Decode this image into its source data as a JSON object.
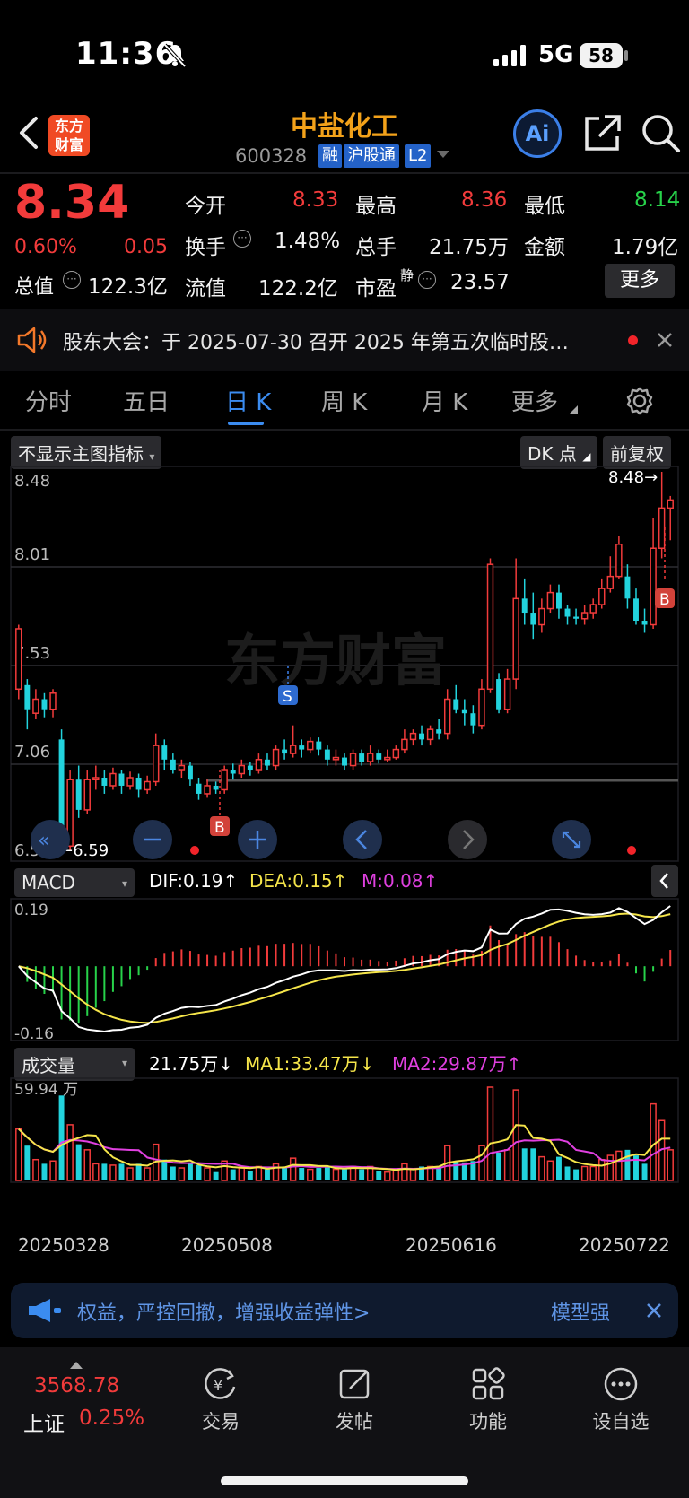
{
  "status": {
    "time": "11:36",
    "network": "5G",
    "battery": "58"
  },
  "nav": {
    "title": "中盐化工",
    "logo_line1": "东方",
    "logo_line2": "财富",
    "code": "600328",
    "badges": [
      "融",
      "沪股通",
      "L2"
    ],
    "ai_label": "Ai"
  },
  "quote": {
    "price": "8.34",
    "change_pct": "0.60%",
    "change": "0.05",
    "open_label": "今开",
    "open": "8.33",
    "high_label": "最高",
    "high": "8.36",
    "low_label": "最低",
    "low": "8.14",
    "turnover_label": "换手",
    "turnover": "1.48%",
    "volume_label": "总手",
    "volume": "21.75万",
    "amount_label": "金额",
    "amount": "1.79亿",
    "mktcap_label": "总值",
    "mktcap": "122.3亿",
    "float_label": "流值",
    "float_cap": "122.2亿",
    "pe_label": "市盈",
    "pe_sup": "静",
    "pe": "23.57",
    "more_label": "更多"
  },
  "notice": {
    "text": "股东大会：于 2025-07-30 召开 2025 年第五次临时股…"
  },
  "tabs": [
    "分时",
    "五日",
    "日 K",
    "周 K",
    "月 K",
    "更多"
  ],
  "kline": {
    "indicator_select": "不显示主图指标",
    "dk_label": "DK 点",
    "adjust_label": "前复权",
    "y_labels": [
      "8.48",
      "8.01",
      "7.53",
      "7.06",
      "6.59"
    ],
    "max_marker": "8.48→",
    "min_marker": "←6.59",
    "watermark": "东方财富",
    "markers": {
      "sell": "S",
      "buy": "B"
    }
  },
  "macd": {
    "select": "MACD",
    "dif": "DIF:0.19↑",
    "dea": "DEA:0.15↑",
    "m": "M:0.08↑",
    "y_top": "0.19",
    "y_bottom": "-0.16"
  },
  "vol": {
    "select": "成交量",
    "value": "21.75万↓",
    "ma1": "MA1:33.47万↓",
    "ma2": "MA2:29.87万↑",
    "y_top": "59.94 万",
    "dates": [
      "20250328",
      "20250508",
      "20250616",
      "20250722"
    ]
  },
  "banner": {
    "text": "权益，严控回撤，增强收益弹性>",
    "right": "模型强"
  },
  "bottom_nav": {
    "index_value": "3568.78",
    "index_name": "上证",
    "index_pct": "0.25%",
    "items": [
      "交易",
      "发帖",
      "功能",
      "设自选"
    ]
  },
  "colors": {
    "up": "#f23b3b",
    "down": "#22d3dd",
    "accent": "#3b8cf0",
    "ma1": "#f5e54a",
    "ma2": "#e040e0"
  },
  "chart_data": {
    "type": "candlestick",
    "ylim": [
      6.59,
      8.48
    ],
    "candles": [
      [
        7.4,
        7.7,
        7.72,
        7.35
      ],
      [
        7.42,
        7.3,
        7.45,
        7.2
      ],
      [
        7.28,
        7.35,
        7.4,
        7.25
      ],
      [
        7.35,
        7.3,
        7.38,
        7.26
      ],
      [
        7.3,
        7.38,
        7.4,
        7.26
      ],
      [
        7.15,
        6.62,
        7.2,
        6.59
      ],
      [
        6.62,
        6.95,
        7.0,
        6.6
      ],
      [
        6.95,
        6.8,
        7.02,
        6.76
      ],
      [
        6.8,
        6.95,
        7.0,
        6.78
      ],
      [
        6.95,
        6.96,
        7.02,
        6.9
      ],
      [
        6.96,
        6.92,
        7.0,
        6.88
      ],
      [
        6.92,
        6.98,
        7.01,
        6.9
      ],
      [
        6.98,
        6.92,
        7.0,
        6.88
      ],
      [
        6.92,
        6.96,
        6.99,
        6.9
      ],
      [
        6.96,
        6.9,
        6.98,
        6.86
      ],
      [
        6.9,
        6.94,
        6.97,
        6.88
      ],
      [
        6.94,
        7.12,
        7.18,
        6.92
      ],
      [
        7.12,
        7.05,
        7.15,
        7.0
      ],
      [
        7.05,
        7.0,
        7.08,
        6.98
      ],
      [
        7.0,
        7.02,
        7.05,
        6.96
      ],
      [
        7.02,
        6.95,
        7.04,
        6.92
      ],
      [
        6.93,
        6.88,
        6.96,
        6.85
      ],
      [
        6.88,
        6.92,
        6.95,
        6.86
      ],
      [
        6.92,
        6.9,
        6.94,
        6.88
      ],
      [
        6.9,
        7.0,
        7.02,
        6.88
      ],
      [
        7.0,
        6.98,
        7.03,
        6.95
      ],
      [
        6.98,
        7.02,
        7.05,
        6.96
      ],
      [
        7.02,
        7.0,
        7.04,
        6.97
      ],
      [
        7.0,
        7.05,
        7.08,
        6.98
      ],
      [
        7.05,
        7.02,
        7.08,
        7.0
      ],
      [
        7.02,
        7.1,
        7.12,
        7.0
      ],
      [
        7.1,
        7.08,
        7.15,
        7.05
      ],
      [
        7.08,
        7.12,
        7.22,
        7.06
      ],
      [
        7.12,
        7.1,
        7.15,
        7.06
      ],
      [
        7.1,
        7.14,
        7.16,
        7.08
      ],
      [
        7.14,
        7.1,
        7.16,
        7.07
      ],
      [
        7.1,
        7.05,
        7.12,
        7.02
      ],
      [
        7.05,
        7.06,
        7.1,
        7.02
      ],
      [
        7.06,
        7.02,
        7.08,
        7.0
      ],
      [
        7.02,
        7.08,
        7.1,
        7.0
      ],
      [
        7.08,
        7.04,
        7.1,
        7.02
      ],
      [
        7.04,
        7.08,
        7.12,
        7.02
      ],
      [
        7.08,
        7.05,
        7.1,
        7.03
      ],
      [
        7.05,
        7.06,
        7.1,
        7.04
      ],
      [
        7.06,
        7.1,
        7.12,
        7.05
      ],
      [
        7.1,
        7.15,
        7.2,
        7.08
      ],
      [
        7.15,
        7.18,
        7.2,
        7.12
      ],
      [
        7.18,
        7.15,
        7.22,
        7.12
      ],
      [
        7.15,
        7.2,
        7.22,
        7.12
      ],
      [
        7.2,
        7.18,
        7.25,
        7.15
      ],
      [
        7.18,
        7.35,
        7.4,
        7.15
      ],
      [
        7.35,
        7.3,
        7.42,
        7.28
      ],
      [
        7.3,
        7.28,
        7.35,
        7.22
      ],
      [
        7.28,
        7.22,
        7.32,
        7.18
      ],
      [
        7.22,
        7.4,
        7.45,
        7.2
      ],
      [
        7.4,
        8.02,
        8.05,
        7.38
      ],
      [
        7.45,
        7.3,
        7.48,
        7.28
      ],
      [
        7.3,
        7.45,
        7.5,
        7.28
      ],
      [
        7.45,
        7.85,
        8.05,
        7.4
      ],
      [
        7.85,
        7.78,
        7.95,
        7.72
      ],
      [
        7.78,
        7.72,
        7.88,
        7.65
      ],
      [
        7.72,
        7.8,
        7.85,
        7.68
      ],
      [
        7.8,
        7.88,
        7.92,
        7.78
      ],
      [
        7.88,
        7.8,
        7.92,
        7.75
      ],
      [
        7.8,
        7.76,
        7.82,
        7.72
      ],
      [
        7.76,
        7.75,
        7.8,
        7.72
      ],
      [
        7.75,
        7.78,
        7.82,
        7.72
      ],
      [
        7.78,
        7.82,
        7.85,
        7.75
      ],
      [
        7.82,
        7.9,
        7.95,
        7.8
      ],
      [
        7.9,
        7.96,
        8.06,
        7.88
      ],
      [
        7.96,
        8.12,
        8.16,
        7.95
      ],
      [
        7.96,
        7.85,
        8.02,
        7.8
      ],
      [
        7.85,
        7.74,
        7.9,
        7.72
      ],
      [
        7.74,
        7.72,
        7.8,
        7.68
      ],
      [
        7.72,
        8.1,
        8.25,
        7.7
      ],
      [
        8.1,
        8.3,
        8.48,
        8.05
      ],
      [
        8.3,
        8.34,
        8.36,
        8.14
      ]
    ]
  }
}
